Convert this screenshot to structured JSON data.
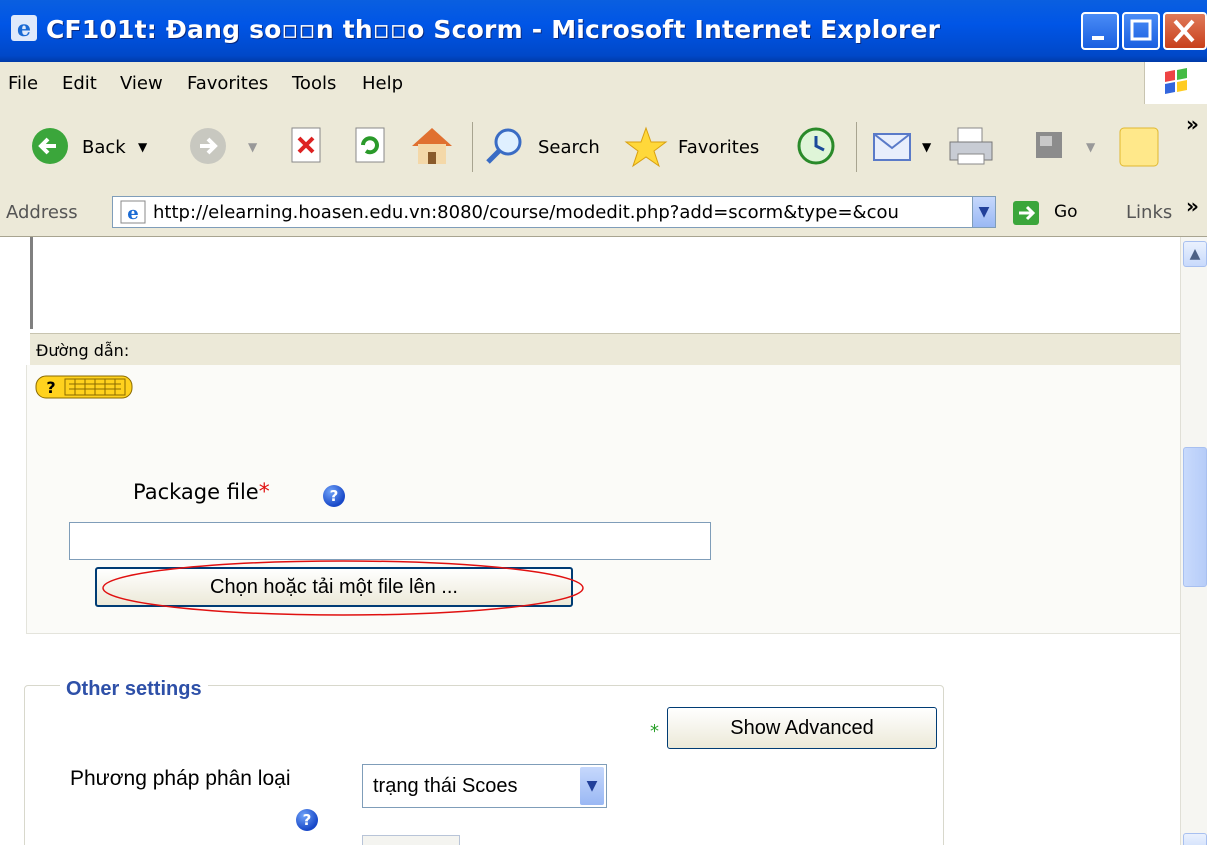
{
  "window": {
    "title": "CF101t: Đang so▫▫n th▫▫o Scorm - Microsoft Internet Explorer"
  },
  "menu": {
    "items": [
      "File",
      "Edit",
      "View",
      "Favorites",
      "Tools",
      "Help"
    ]
  },
  "toolbar": {
    "back_label": "Back",
    "search_label": "Search",
    "favorites_label": "Favorites"
  },
  "address": {
    "label": "Address",
    "url": "http://elearning.hoasen.edu.vn:8080/course/modedit.php?add=scorm&type=&cou",
    "go_label": "Go",
    "links_label": "Links"
  },
  "editor": {
    "path_label": "Đường dẫn:"
  },
  "package": {
    "label": "Package file",
    "required_mark": "*",
    "file_value": "",
    "choose_button": "Chọn hoặc tải một file lên ..."
  },
  "other_settings": {
    "legend": "Other settings",
    "show_advanced": "Show Advanced",
    "advanced_mark": "*",
    "grading_label": "Phương pháp phân loại",
    "grading_value": "trạng thái Scoes"
  },
  "colors": {
    "titlebar": "#0055e6",
    "chrome": "#ece9d8",
    "legend": "#2e50a8",
    "annotation": "#e01010"
  }
}
